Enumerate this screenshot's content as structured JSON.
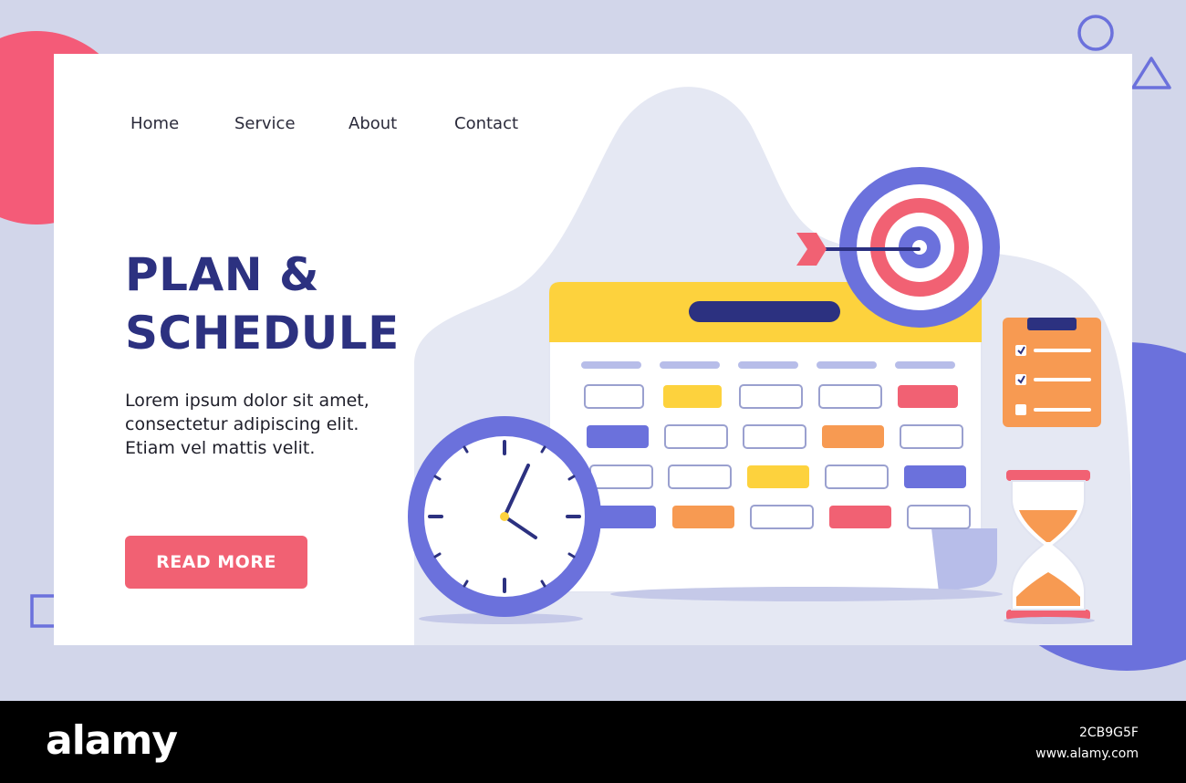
{
  "nav": {
    "home": "Home",
    "service": "Service",
    "about": "About",
    "contact": "Contact"
  },
  "hero": {
    "title_line1": "PLAN &",
    "title_line2": "SCHEDULE",
    "body_lines": [
      "Lorem ipsum dolor sit amet,",
      "consectetur adipiscing elit.",
      "Etiam vel mattis velit."
    ],
    "cta_label": "READ MORE"
  },
  "footer": {
    "logo": "alamy",
    "image_id": "2CB9G5F",
    "url": "www.alamy.com"
  },
  "colors": {
    "primary_dark": "#2c3180",
    "accent_pink": "#f16173",
    "accent_yellow": "#fdd23d",
    "accent_orange": "#f79a52",
    "accent_blue": "#6b71dc",
    "background": "#d2d6ea"
  },
  "icons": [
    "calendar-icon",
    "clock-icon",
    "target-icon",
    "arrow-icon",
    "checklist-icon",
    "hourglass-icon"
  ]
}
